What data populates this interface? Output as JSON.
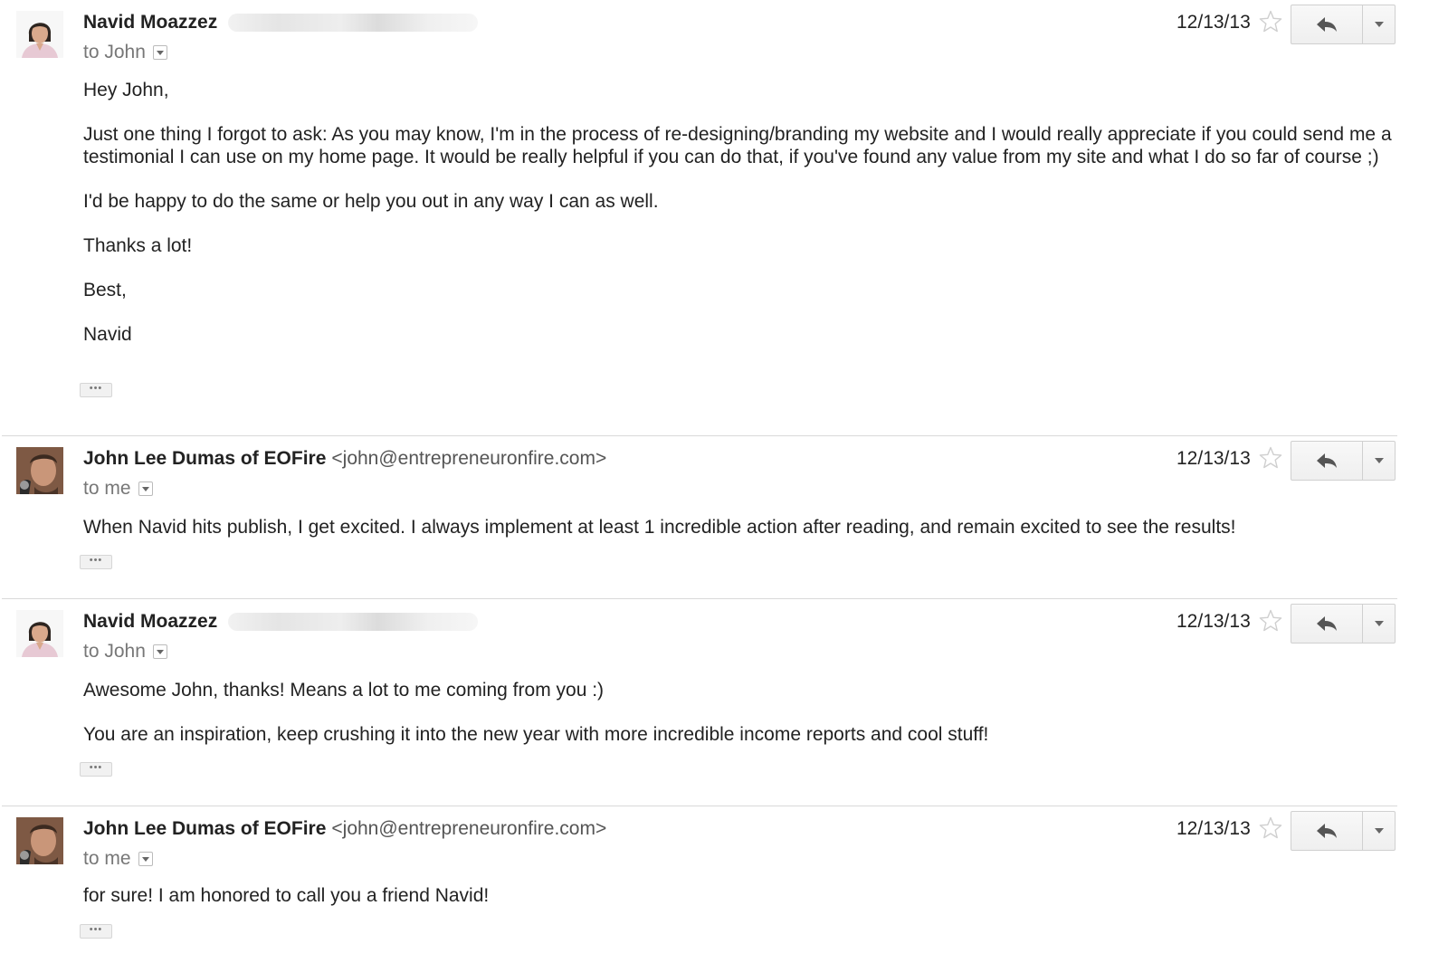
{
  "messages": [
    {
      "sender_name": "Navid Moazzez",
      "sender_email": "",
      "recipient": "to John",
      "date": "12/13/13",
      "paragraphs": [
        "Hey John,",
        "Just one thing I forgot to ask: As you may know, I'm in the process of re-designing/branding my website and I would really appreciate if you could send me a testimonial I can use on my home page. It would be really helpful if you can do that, if you've found any value from my site and what I do so far of course ;)",
        "I'd be happy to do the same or help you out in any way I can as well.",
        "Thanks a lot!",
        "Best,",
        "Navid"
      ],
      "trimmed_label": "•••"
    },
    {
      "sender_name": "John Lee Dumas of EOFire",
      "sender_email": "<john@entrepreneuronfire.com>",
      "recipient": "to me",
      "date": "12/13/13",
      "paragraphs": [
        "When Navid hits publish, I get excited. I always implement at least 1 incredible action after reading, and remain excited to see the results!"
      ],
      "trimmed_label": "•••"
    },
    {
      "sender_name": "Navid Moazzez",
      "sender_email": "",
      "recipient": "to John",
      "date": "12/13/13",
      "paragraphs": [
        "Awesome John, thanks! Means a lot to me coming from you :)",
        "You are an inspiration, keep crushing it into the new year with more incredible income reports and cool stuff!"
      ],
      "trimmed_label": "•••"
    },
    {
      "sender_name": "John Lee Dumas of EOFire",
      "sender_email": "<john@entrepreneuronfire.com>",
      "recipient": "to me",
      "date": "12/13/13",
      "paragraphs": [
        "for sure! I am honored to call you a friend Navid!"
      ],
      "trimmed_label": "•••"
    }
  ],
  "icons": {
    "star": "star-outline-icon",
    "reply": "reply-arrow-icon",
    "more": "chevron-down-icon",
    "recipient_details": "chevron-down-icon"
  },
  "colors": {
    "text": "#222222",
    "muted": "#777777",
    "divider": "#d9d9d9",
    "button_border": "#d0d0d0"
  }
}
